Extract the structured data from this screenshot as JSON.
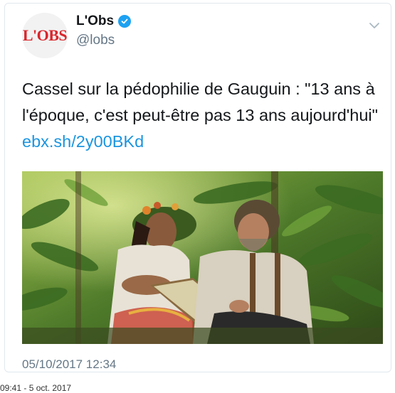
{
  "tweet": {
    "avatar_text": "L'OBS",
    "display_name": "L'Obs",
    "handle": "@lobs",
    "text": "Cassel sur la pédophilie de Gauguin : \"13 ans à l'époque, c'est peut-être pas 13 ans aujourd'hui\"",
    "link": "ebx.sh/2y00BKd",
    "timestamp": "05/10/2017 12:34"
  },
  "status_bar": {
    "text": "09:41 - 5 oct. 2017"
  },
  "icons": {
    "verified": "verified-badge-icon",
    "menu": "chevron-down-icon"
  },
  "colors": {
    "brand_red": "#d9262c",
    "link_blue": "#1b95e0",
    "verified_blue": "#1da1f2",
    "muted_gray": "#657786"
  }
}
